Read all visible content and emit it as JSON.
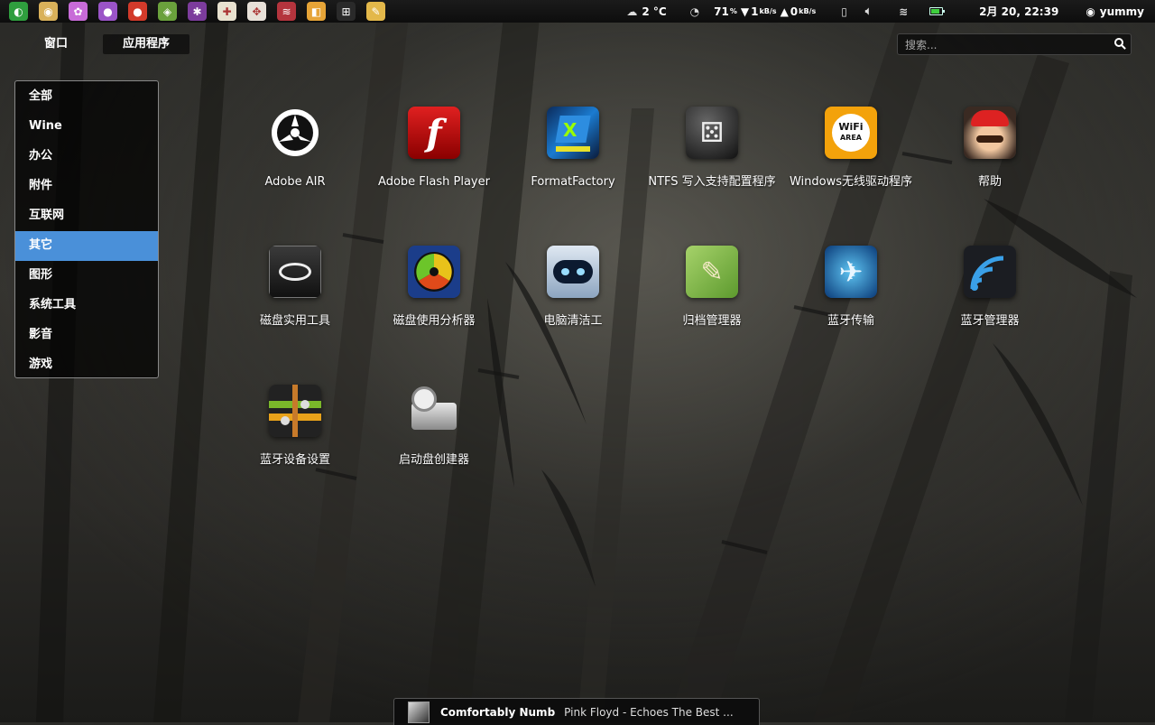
{
  "top_panel": {
    "launcher_icons": [
      {
        "name": "deepin-icon",
        "bg": "#2f9e3e",
        "glyph": "◐"
      },
      {
        "name": "security-camera-icon",
        "bg": "#d9b15a",
        "glyph": "◉"
      },
      {
        "name": "photos-icon",
        "bg": "#c86bd8",
        "glyph": "✿"
      },
      {
        "name": "chat-icon",
        "bg": "#9a54c7",
        "glyph": "●"
      },
      {
        "name": "angry-birds-icon",
        "bg": "#d23a2a",
        "glyph": "●"
      },
      {
        "name": "android-icon",
        "bg": "#6aa13c",
        "glyph": "◈"
      },
      {
        "name": "plant-icon",
        "bg": "#7c3c9c",
        "glyph": "✱"
      },
      {
        "name": "mahjong-icon",
        "bg": "#e8e1cf",
        "glyph": "✚"
      },
      {
        "name": "puzzle-icon",
        "bg": "#e7e0d8",
        "glyph": "✥"
      },
      {
        "name": "zebra-icon",
        "bg": "#b4343d",
        "glyph": "≋"
      },
      {
        "name": "office-icon",
        "bg": "#e6a437",
        "glyph": "◧"
      },
      {
        "name": "windows-icon",
        "bg": "#2a2a2a",
        "glyph": "⊞"
      },
      {
        "name": "notes-icon",
        "bg": "#e3b84a",
        "glyph": "✎"
      }
    ],
    "weather": "2 °C",
    "cpu": "71",
    "cpu_unit": "%",
    "net_down": "1",
    "net_down_unit": "kB/s",
    "net_up": "0",
    "net_up_unit": "kB/s",
    "datetime": "2月 20, 22:39",
    "user": "yummy"
  },
  "tabs": {
    "windows": "窗口",
    "applications": "应用程序"
  },
  "search": {
    "placeholder": "搜索..."
  },
  "categories": [
    "全部",
    "Wine",
    "办公",
    "附件",
    "互联网",
    "其它",
    "图形",
    "系统工具",
    "影音",
    "游戏"
  ],
  "active_category": "其它",
  "apps": [
    {
      "label": "Adobe AIR",
      "icon": "adobe-air-icon"
    },
    {
      "label": "Adobe Flash Player",
      "icon": "adobe-flash-icon"
    },
    {
      "label": "FormatFactory",
      "icon": "format-factory-icon"
    },
    {
      "label": "NTFS 写入支持配置程序",
      "icon": "ntfs-config-icon"
    },
    {
      "label": "Windows无线驱动程序",
      "icon": "wifi-area-icon"
    },
    {
      "label": "帮助",
      "icon": "help-mario-icon"
    },
    {
      "label": "磁盘实用工具",
      "icon": "disk-utility-icon"
    },
    {
      "label": "磁盘使用分析器",
      "icon": "disk-usage-analyzer-icon"
    },
    {
      "label": "电脑清洁工",
      "icon": "computer-janitor-icon"
    },
    {
      "label": "归档管理器",
      "icon": "archive-manager-icon"
    },
    {
      "label": "蓝牙传输",
      "icon": "bluetooth-transfer-icon"
    },
    {
      "label": "蓝牙管理器",
      "icon": "bluetooth-manager-icon"
    },
    {
      "label": "蓝牙设备设置",
      "icon": "bluetooth-settings-icon"
    },
    {
      "label": "启动盘创建器",
      "icon": "startup-disk-creator-icon"
    }
  ],
  "now_playing": {
    "title": "Comfortably Numb",
    "artist": "Pink Floyd - Echoes The Best ..."
  },
  "colors": {
    "accent": "#4a90d9",
    "panel": "#111111"
  }
}
